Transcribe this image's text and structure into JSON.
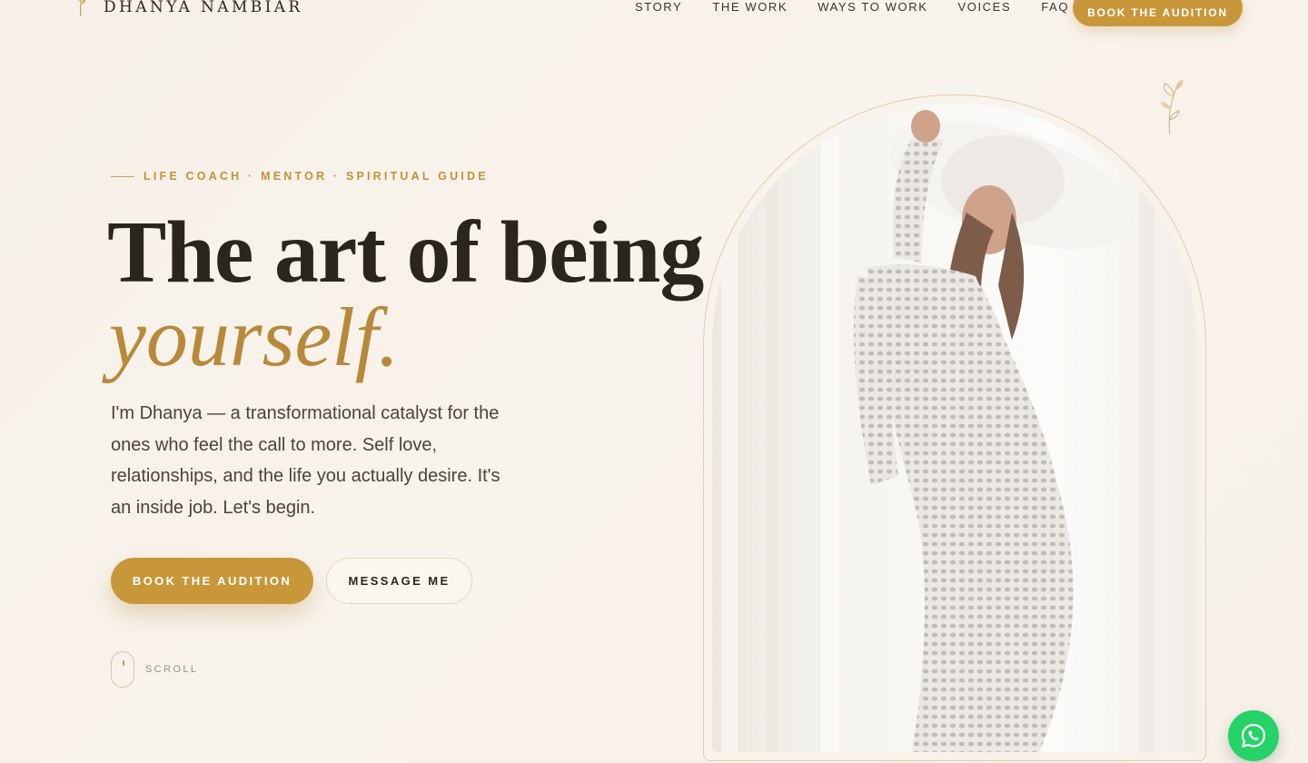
{
  "header": {
    "brand": "DHANYA NAMBIAR",
    "nav": [
      {
        "label": "STORY"
      },
      {
        "label": "THE WORK"
      },
      {
        "label": "WAYS TO WORK"
      },
      {
        "label": "VOICES"
      },
      {
        "label": "FAQ"
      }
    ],
    "cta_label": "BOOK THE AUDITION"
  },
  "hero": {
    "eyebrow": "LIFE COACH · MENTOR · SPIRITUAL GUIDE",
    "title_line1": "The art of being",
    "title_line2": "yourself.",
    "intro": "I'm Dhanya — a transformational catalyst for the ones who feel the call to more. Self love, relationships, and the life you actually desire. It's an inside job. Let's begin.",
    "primary_button": "BOOK THE AUDITION",
    "secondary_button": "MESSAGE ME",
    "scroll_label": "SCROLL"
  },
  "colors": {
    "accent": "#c8973a",
    "background": "#f7f1e8",
    "whatsapp": "#25d366"
  },
  "icons": [
    "logo-sprig-icon",
    "leaf-sprig-icon",
    "mouse-scroll-icon",
    "whatsapp-icon"
  ]
}
